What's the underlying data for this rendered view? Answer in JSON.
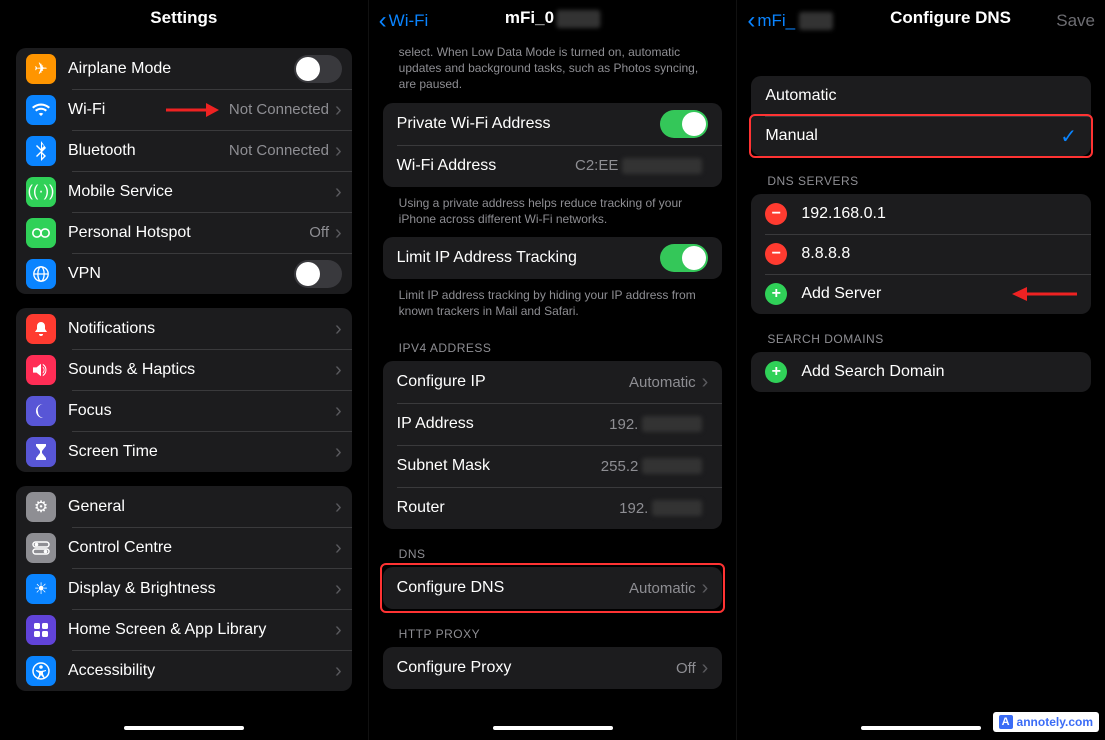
{
  "pane1": {
    "title": "Settings",
    "group1": [
      {
        "icon": "airplane-icon",
        "label": "Airplane Mode",
        "type": "switch",
        "on": false
      },
      {
        "icon": "wifi-icon",
        "label": "Wi-Fi",
        "type": "link",
        "value": "Not Connected",
        "highlighted": true
      },
      {
        "icon": "bluetooth-icon",
        "label": "Bluetooth",
        "type": "link",
        "value": "Not Connected"
      },
      {
        "icon": "mobile-icon",
        "label": "Mobile Service",
        "type": "link"
      },
      {
        "icon": "hotspot-icon",
        "label": "Personal Hotspot",
        "type": "link",
        "value": "Off"
      },
      {
        "icon": "vpn-icon",
        "label": "VPN",
        "type": "switch",
        "on": false
      }
    ],
    "group2": [
      {
        "icon": "notifications-icon",
        "label": "Notifications",
        "type": "link"
      },
      {
        "icon": "sounds-icon",
        "label": "Sounds & Haptics",
        "type": "link"
      },
      {
        "icon": "focus-icon",
        "label": "Focus",
        "type": "link"
      },
      {
        "icon": "screentime-icon",
        "label": "Screen Time",
        "type": "link"
      }
    ],
    "group3": [
      {
        "icon": "general-icon",
        "label": "General",
        "type": "link"
      },
      {
        "icon": "controlcentre-icon",
        "label": "Control Centre",
        "type": "link"
      },
      {
        "icon": "display-icon",
        "label": "Display & Brightness",
        "type": "link"
      },
      {
        "icon": "homescreen-icon",
        "label": "Home Screen & App Library",
        "type": "link"
      },
      {
        "icon": "accessibility-icon",
        "label": "Accessibility",
        "type": "link"
      }
    ]
  },
  "pane2": {
    "back": "Wi-Fi",
    "title": "mFi_0",
    "topHelp": "select. When Low Data Mode is turned on, automatic updates and background tasks, such as Photos syncing, are paused.",
    "privateRow": {
      "label": "Private Wi-Fi Address",
      "on": true
    },
    "wifiAddr": {
      "label": "Wi-Fi Address",
      "value": "C2:EE"
    },
    "privHelp": "Using a private address helps reduce tracking of your iPhone across different Wi-Fi networks.",
    "limitRow": {
      "label": "Limit IP Address Tracking",
      "on": true
    },
    "limitHelp": "Limit IP address tracking by hiding your IP address from known trackers in Mail and Safari.",
    "ipv4Section": "IPV4 ADDRESS",
    "ipv4Rows": [
      {
        "label": "Configure IP",
        "value": "Automatic",
        "chev": true
      },
      {
        "label": "IP Address",
        "value": "192."
      },
      {
        "label": "Subnet Mask",
        "value": "255.2"
      },
      {
        "label": "Router",
        "value": "192."
      }
    ],
    "dnsSection": "DNS",
    "dnsRow": {
      "label": "Configure DNS",
      "value": "Automatic",
      "chev": true,
      "highlighted": true
    },
    "proxySection": "HTTP PROXY",
    "proxyRow": {
      "label": "Configure Proxy",
      "value": "Off",
      "chev": true
    }
  },
  "pane3": {
    "back": "mFi_",
    "title": "Configure DNS",
    "save": "Save",
    "modeAuto": "Automatic",
    "modeManual": "Manual",
    "serversSection": "DNS SERVERS",
    "servers": [
      "192.168.0.1",
      "8.8.8.8"
    ],
    "addServer": "Add Server",
    "searchSection": "SEARCH DOMAINS",
    "addSearch": "Add Search Domain"
  },
  "watermark": "annotely.com"
}
